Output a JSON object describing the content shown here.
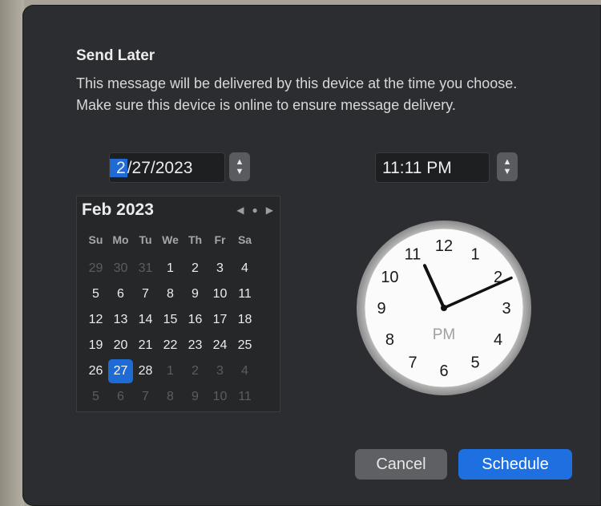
{
  "dialog": {
    "title": "Send Later",
    "description": "This message will be delivered by this device at the time you choose. Make sure this device is online to ensure message delivery."
  },
  "date_field": {
    "selected_part": "2",
    "rest": "/27/2023"
  },
  "time_field": {
    "value": "11:11 PM"
  },
  "calendar": {
    "month_label": "Feb 2023",
    "weekdays": [
      "Su",
      "Mo",
      "Tu",
      "We",
      "Th",
      "Fr",
      "Sa"
    ],
    "days": [
      [
        "29",
        "30",
        "31",
        "1",
        "2",
        "3",
        "4"
      ],
      [
        "5",
        "6",
        "7",
        "8",
        "9",
        "10",
        "11"
      ],
      [
        "12",
        "13",
        "14",
        "15",
        "16",
        "17",
        "18"
      ],
      [
        "19",
        "20",
        "21",
        "22",
        "23",
        "24",
        "25"
      ],
      [
        "26",
        "27",
        "28",
        "1",
        "2",
        "3",
        "4"
      ],
      [
        "5",
        "6",
        "7",
        "8",
        "9",
        "10",
        "11"
      ]
    ],
    "selected_day": "27"
  },
  "clock": {
    "numbers": [
      "12",
      "1",
      "2",
      "3",
      "4",
      "5",
      "6",
      "7",
      "8",
      "9",
      "10",
      "11"
    ],
    "period_label": "PM",
    "hour": 11,
    "minute": 11
  },
  "buttons": {
    "cancel": "Cancel",
    "schedule": "Schedule"
  },
  "colors": {
    "accent": "#1e6fe0",
    "panel": "#2c2d30"
  }
}
